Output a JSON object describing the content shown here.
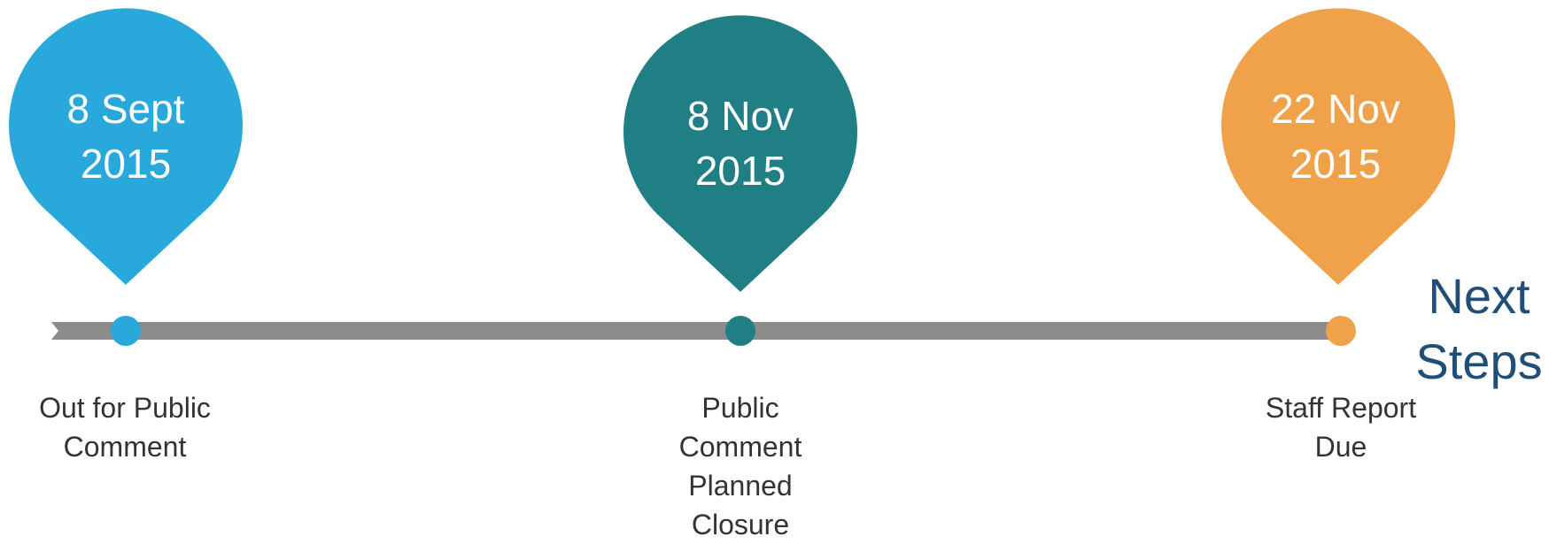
{
  "heading": {
    "line1": "Next",
    "line2": "Steps"
  },
  "milestones": [
    {
      "date_line1": "8 Sept",
      "date_line2": "2015",
      "label_lines": [
        "Out for Public",
        "Comment"
      ],
      "color": "#29a8db"
    },
    {
      "date_line1": "8 Nov",
      "date_line2": "2015",
      "label_lines": [
        "Public",
        "Comment",
        "Planned",
        "Closure"
      ],
      "color": "#1f7f85"
    },
    {
      "date_line1": "22 Nov",
      "date_line2": "2015",
      "label_lines": [
        "Staff Report",
        "Due"
      ],
      "color": "#f0a24a"
    }
  ],
  "colors": {
    "track": "#8c8c8c",
    "heading": "#1f4e79",
    "label": "#333333"
  }
}
